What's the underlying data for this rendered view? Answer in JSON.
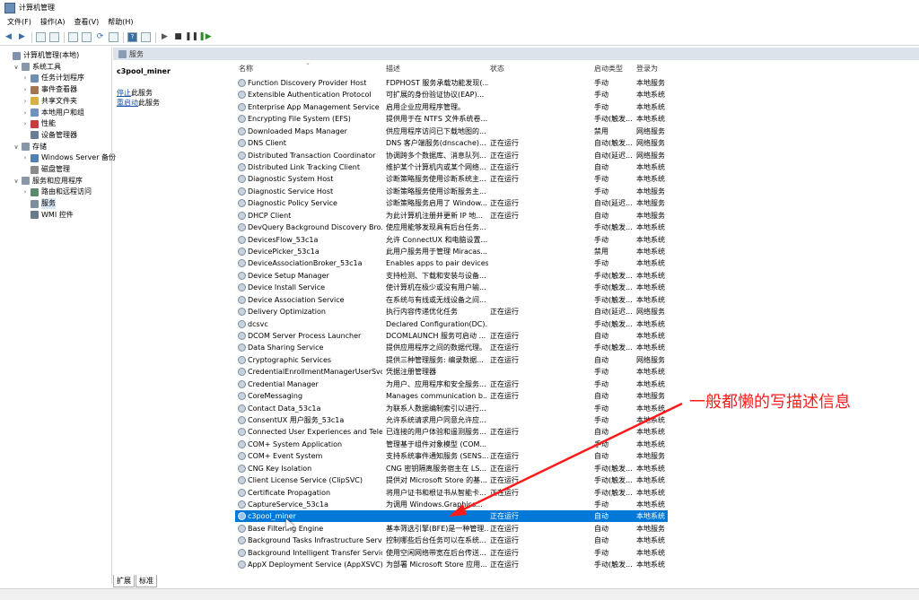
{
  "window": {
    "title": "计算机管理"
  },
  "menu": [
    "文件(F)",
    "操作(A)",
    "查看(V)",
    "帮助(H)"
  ],
  "toolbar_icons": [
    "back-arrow-icon",
    "forward-arrow-icon",
    "up-folder-icon",
    "show-tree-icon",
    "properties-icon",
    "export-icon",
    "refresh-icon",
    "new-window-icon",
    "help-icon",
    "display-icon",
    "play-icon",
    "stop-icon",
    "pause-icon",
    "resume-icon"
  ],
  "tree": [
    {
      "label": "计算机管理(本地)",
      "level": 0,
      "expander": "",
      "color": "#7d93ad"
    },
    {
      "label": "系统工具",
      "level": 1,
      "expander": "∨",
      "color": "#8897a8"
    },
    {
      "label": "任务计划程序",
      "level": 2,
      "expander": "›",
      "color": "#6f8fb0"
    },
    {
      "label": "事件查看器",
      "level": 2,
      "expander": "›",
      "color": "#a07850"
    },
    {
      "label": "共享文件夹",
      "level": 2,
      "expander": "›",
      "color": "#d8b040"
    },
    {
      "label": "本地用户和组",
      "level": 2,
      "expander": "›",
      "color": "#7090c0"
    },
    {
      "label": "性能",
      "level": 2,
      "expander": "›",
      "color": "#c04040"
    },
    {
      "label": "设备管理器",
      "level": 2,
      "expander": "",
      "color": "#6a7f95"
    },
    {
      "label": "存储",
      "level": 1,
      "expander": "∨",
      "color": "#8897a8"
    },
    {
      "label": "Windows Server 备份",
      "level": 2,
      "expander": "›",
      "color": "#5080b0"
    },
    {
      "label": "磁盘管理",
      "level": 2,
      "expander": "",
      "color": "#8a8a8a"
    },
    {
      "label": "服务和应用程序",
      "level": 1,
      "expander": "∨",
      "color": "#8897a8"
    },
    {
      "label": "路由和远程访问",
      "level": 2,
      "expander": "›",
      "color": "#5a8a6a"
    },
    {
      "label": "服务",
      "level": 2,
      "expander": "",
      "color": "#7e8e9e",
      "selected": true
    },
    {
      "label": "WMI 控件",
      "level": 2,
      "expander": "",
      "color": "#6a7a8a"
    }
  ],
  "header_bar": {
    "label": "服务"
  },
  "middle": {
    "service_name": "c3pool_miner",
    "stop_link": "停止",
    "stop_text": "此服务",
    "restart_link": "重启动",
    "restart_text": "此服务"
  },
  "columns": {
    "name": "名称",
    "desc": "描述",
    "state": "状态",
    "startup": "启动类型",
    "logon": "登录为"
  },
  "rows": [
    [
      "Function Discovery Provider Host",
      "FDPHOST 服务承载功能发现(...",
      "",
      "手动",
      "本地服务"
    ],
    [
      "Extensible Authentication Protocol",
      "可扩展的身份验证协议(EAP)...",
      "",
      "手动",
      "本地系统"
    ],
    [
      "Enterprise App Management Service",
      "启用企业应用程序管理。",
      "",
      "手动",
      "本地系统"
    ],
    [
      "Encrypting File System (EFS)",
      "提供用于在 NTFS 文件系统卷...",
      "",
      "手动(触发...",
      "本地系统"
    ],
    [
      "Downloaded Maps Manager",
      "供应用程序访问已下载地图的...",
      "",
      "禁用",
      "网络服务"
    ],
    [
      "DNS Client",
      "DNS 客户端服务(dnscache)...",
      "正在运行",
      "自动(触发...",
      "网络服务"
    ],
    [
      "Distributed Transaction Coordinator",
      "协调跨多个数据库、消息队列...",
      "正在运行",
      "自动(延迟...",
      "网络服务"
    ],
    [
      "Distributed Link Tracking Client",
      "维护某个计算机内或某个网络...",
      "正在运行",
      "自动",
      "本地系统"
    ],
    [
      "Diagnostic System Host",
      "诊断策略服务使用诊断系统主...",
      "正在运行",
      "手动",
      "本地系统"
    ],
    [
      "Diagnostic Service Host",
      "诊断策略服务使用诊断服务主...",
      "",
      "手动",
      "本地服务"
    ],
    [
      "Diagnostic Policy Service",
      "诊断策略服务启用了 Window...",
      "正在运行",
      "自动(延迟...",
      "本地服务"
    ],
    [
      "DHCP Client",
      "为此计算机注册并更新 IP 地...",
      "正在运行",
      "自动",
      "本地服务"
    ],
    [
      "DevQuery Background Discovery Bro...",
      "使应用能够发现具有后台任务...",
      "",
      "手动(触发...",
      "本地系统"
    ],
    [
      "DevicesFlow_53c1a",
      "允许 ConnectUX 和电脑设置...",
      "",
      "手动",
      "本地系统"
    ],
    [
      "DevicePicker_53c1a",
      "此用户服务用于管理 Miracas...",
      "",
      "禁用",
      "本地系统"
    ],
    [
      "DeviceAssociationBroker_53c1a",
      "Enables apps to pair devices",
      "",
      "手动",
      "本地系统"
    ],
    [
      "Device Setup Manager",
      "支持检测、下载和安装与设备...",
      "",
      "手动(触发...",
      "本地系统"
    ],
    [
      "Device Install Service",
      "使计算机在极少或没有用户输...",
      "",
      "手动(触发...",
      "本地系统"
    ],
    [
      "Device Association Service",
      "在系统与有线或无线设备之间...",
      "",
      "手动(触发...",
      "本地系统"
    ],
    [
      "Delivery Optimization",
      "执行内容传递优化任务",
      "正在运行",
      "自动(延迟...",
      "网络服务"
    ],
    [
      "dcsvc",
      "Declared Configuration(DC)...",
      "",
      "手动(触发...",
      "本地系统"
    ],
    [
      "DCOM Server Process Launcher",
      "DCOMLAUNCH 服务可启动 ...",
      "正在运行",
      "自动",
      "本地系统"
    ],
    [
      "Data Sharing Service",
      "提供应用程序之间的数据代理。",
      "正在运行",
      "手动(触发...",
      "本地系统"
    ],
    [
      "Cryptographic Services",
      "提供三种管理服务: 编录数据...",
      "正在运行",
      "自动",
      "网络服务"
    ],
    [
      "CredentialEnrollmentManagerUserSvc...",
      "凭据注册管理器",
      "",
      "手动",
      "本地系统"
    ],
    [
      "Credential Manager",
      "为用户、应用程序和安全服务...",
      "正在运行",
      "手动",
      "本地系统"
    ],
    [
      "CoreMessaging",
      "Manages communication b...",
      "正在运行",
      "自动",
      "本地服务"
    ],
    [
      "Contact Data_53c1a",
      "为联系人数据编制索引以进行...",
      "",
      "手动",
      "本地系统"
    ],
    [
      "ConsentUX 用户服务_53c1a",
      "允许系统请求用户同意允许应...",
      "",
      "手动",
      "本地系统"
    ],
    [
      "Connected User Experiences and Tele...",
      "已连接的用户体验和遥测服务...",
      "正在运行",
      "自动",
      "本地系统"
    ],
    [
      "COM+ System Application",
      "管理基于组件对象模型 (COM...",
      "",
      "手动",
      "本地系统"
    ],
    [
      "COM+ Event System",
      "支持系统事件通知服务 (SENS...",
      "正在运行",
      "自动",
      "本地服务"
    ],
    [
      "CNG Key Isolation",
      "CNG 密钥隔离服务宿主在 LS...",
      "正在运行",
      "手动(触发...",
      "本地系统"
    ],
    [
      "Client License Service (ClipSVC)",
      "提供对 Microsoft Store 的基...",
      "正在运行",
      "手动(触发...",
      "本地系统"
    ],
    [
      "Certificate Propagation",
      "将用户证书和根证书从智能卡...",
      "正在运行",
      "手动(触发...",
      "本地系统"
    ],
    [
      "CaptureService_53c1a",
      "为调用 Windows.Graphics...",
      "",
      "手动",
      "本地系统"
    ],
    [
      "c3pool_miner",
      "",
      "正在运行",
      "自动",
      "本地系统"
    ],
    [
      "Base Filtering Engine",
      "基本筛选引擎(BFE)是一种管理...",
      "正在运行",
      "自动",
      "本地服务"
    ],
    [
      "Background Tasks Infrastructure Servi...",
      "控制哪些后台任务可以在系统...",
      "正在运行",
      "自动",
      "本地系统"
    ],
    [
      "Background Intelligent Transfer Service",
      "使用空闲网络带宽在后台传送...",
      "正在运行",
      "手动",
      "本地系统"
    ],
    [
      "AppX Deployment Service (AppXSVC)",
      "为部署 Microsoft Store 应用...",
      "正在运行",
      "手动(触发...",
      "本地系统"
    ]
  ],
  "selected_row": 36,
  "bottom_tabs": [
    "扩展",
    "标准"
  ],
  "annotation": {
    "text": "一般都懒的写描述信息",
    "color": "#ff1a1a"
  },
  "colors": {
    "selection": "#0078d7",
    "header_bar": "#dde3ea",
    "link": "#1a55a8"
  }
}
